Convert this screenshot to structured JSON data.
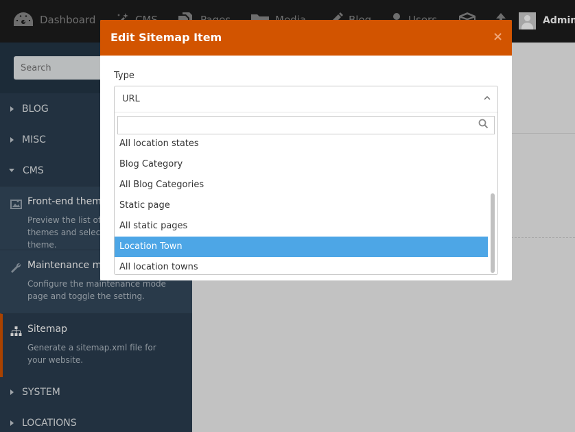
{
  "topnav": {
    "items": [
      {
        "label": "Dashboard",
        "icon": "dashboard-icon"
      },
      {
        "label": "CMS",
        "icon": "magic-wand-icon"
      },
      {
        "label": "Pages",
        "icon": "copy-icon"
      },
      {
        "label": "Media",
        "icon": "folder-icon"
      },
      {
        "label": "Blog",
        "icon": "pencil-icon"
      },
      {
        "label": "Users",
        "icon": "user-icon"
      },
      {
        "label": "",
        "icon": "box-icon"
      },
      {
        "label": "",
        "icon": "upload-icon"
      }
    ],
    "user_name": "Admin"
  },
  "sidebar": {
    "search_placeholder": "Search",
    "groups": {
      "blog": "BLOG",
      "misc": "MISC",
      "cms": "CMS",
      "system": "SYSTEM",
      "locations": "LOCATIONS"
    },
    "entries": [
      {
        "title": "Front-end theme",
        "desc": "Preview the list of installed themes and select an active theme.",
        "icon": "image-icon"
      },
      {
        "title": "Maintenance mode",
        "desc": "Configure the maintenance mode page and toggle the setting.",
        "icon": "wrench-icon"
      },
      {
        "title": "Sitemap",
        "desc": "Generate a sitemap.xml file for your website.",
        "icon": "sitemap-icon"
      }
    ]
  },
  "modal": {
    "title": "Edit Sitemap Item",
    "close": "×",
    "type_label": "Type",
    "selected_value": "URL",
    "search_value": "",
    "options": [
      "All location states",
      "Blog Category",
      "All Blog Categories",
      "Static page",
      "All static pages",
      "Location Town",
      "All location towns"
    ],
    "highlighted_option": "Location Town"
  },
  "colors": {
    "accent": "#d25400",
    "highlight": "#4da6e6",
    "sidebar_bg": "#2b3e50",
    "topbar_bg": "#1d1d1d"
  }
}
